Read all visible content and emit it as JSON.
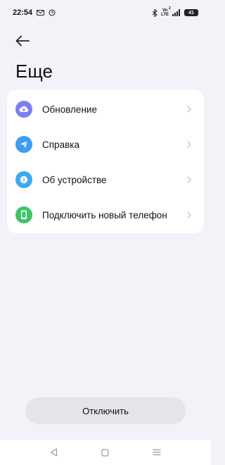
{
  "status_bar": {
    "time": "22:54",
    "battery": "41",
    "net_label_top": "2",
    "net_label_vo": "Vo",
    "net_label_lte": "LTE"
  },
  "header": {
    "title": "Еще"
  },
  "menu": {
    "items": [
      {
        "label": "Обновление",
        "icon": "cloud-upload-icon",
        "color": "#7b7ef3"
      },
      {
        "label": "Справка",
        "icon": "send-icon",
        "color": "#3d9cf0"
      },
      {
        "label": "Об устройстве",
        "icon": "info-icon",
        "color": "#3ea8f4"
      },
      {
        "label": "Подключить новый телефон",
        "icon": "phone-icon",
        "color": "#3dc46a"
      }
    ]
  },
  "footer": {
    "disable_label": "Отключить"
  },
  "colors": {
    "background": "#f2f2f8",
    "card": "#ffffff",
    "button": "#e4e4ea"
  }
}
